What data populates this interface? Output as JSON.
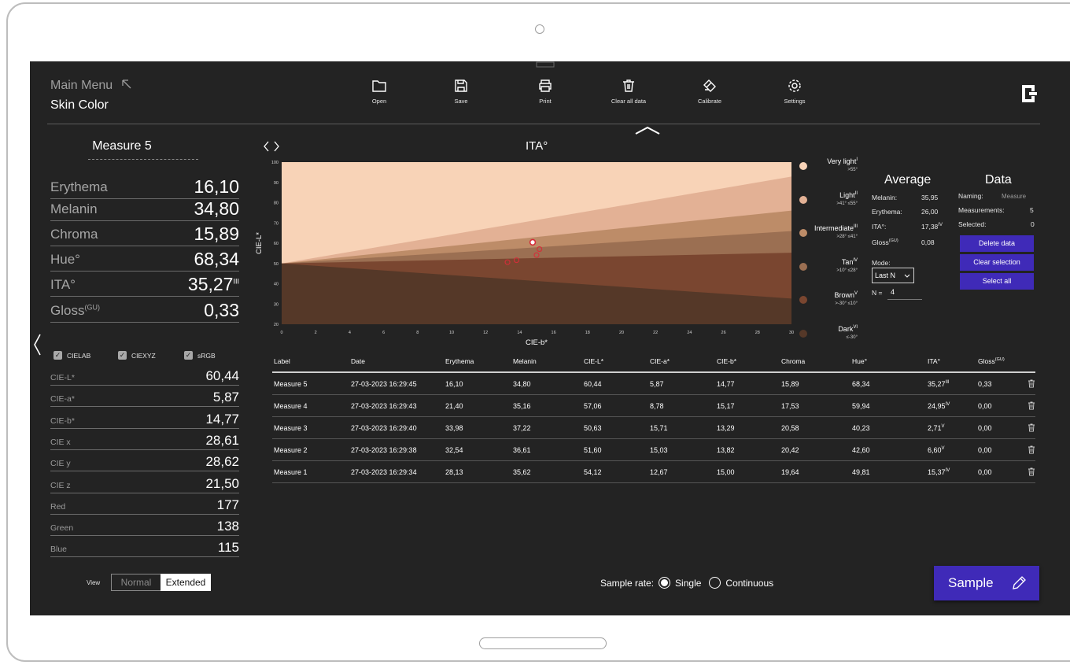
{
  "header": {
    "menu_title": "Main Menu",
    "app_title": "Skin Color",
    "toolbar": [
      {
        "label": "Open",
        "icon": "folder-icon"
      },
      {
        "label": "Save",
        "icon": "save-icon"
      },
      {
        "label": "Print",
        "icon": "print-icon"
      },
      {
        "label": "Clear all data",
        "icon": "trash-icon"
      },
      {
        "label": "Calibrate",
        "icon": "calibrate-icon"
      },
      {
        "label": "Settings",
        "icon": "gear-icon"
      }
    ]
  },
  "measure": {
    "title": "Measure 5",
    "main": [
      {
        "label": "Erythema",
        "value": "16,10"
      },
      {
        "label": "Melanin",
        "value": "34,80"
      },
      {
        "label": "Chroma",
        "value": "15,89"
      },
      {
        "label": "Hue°",
        "value": "68,34"
      },
      {
        "label": "ITA°",
        "value": "35,27",
        "sup": "III"
      },
      {
        "label": "Gloss",
        "label_sup": "(GU)",
        "value": "0,33"
      }
    ],
    "checkboxes": [
      "CIELAB",
      "CIEXYZ",
      "sRGB"
    ],
    "extended": [
      {
        "label": "CIE-L*",
        "value": "60,44"
      },
      {
        "label": "CIE-a*",
        "value": "5,87"
      },
      {
        "label": "CIE-b*",
        "value": "14,77"
      },
      {
        "label": "CIE x",
        "value": "28,61"
      },
      {
        "label": "CIE y",
        "value": "28,62"
      },
      {
        "label": "CIE z",
        "value": "21,50"
      },
      {
        "label": "Red",
        "value": "177"
      },
      {
        "label": "Green",
        "value": "138"
      },
      {
        "label": "Blue",
        "value": "115"
      }
    ],
    "view_label": "View",
    "view_normal": "Normal",
    "view_extended": "Extended"
  },
  "chart_data": {
    "type": "scatter",
    "title": "ITA°",
    "xlabel": "CIE-b*",
    "ylabel": "CIE-L*",
    "xlim": [
      0,
      30
    ],
    "ylim": [
      20,
      100
    ],
    "x_ticks": [
      "0",
      "2",
      "4",
      "6",
      "8",
      "10",
      "12",
      "14",
      "16",
      "18",
      "20",
      "22",
      "24",
      "26",
      "28",
      "30"
    ],
    "y_ticks": [
      "20",
      "30",
      "40",
      "50",
      "60",
      "70",
      "80",
      "90",
      "100"
    ],
    "grid": false,
    "legend_placement": "right",
    "points": [
      {
        "label": "Measure 5",
        "x": 14.77,
        "y": 60.44,
        "selected": true
      },
      {
        "label": "Measure 4",
        "x": 15.17,
        "y": 57.06
      },
      {
        "label": "Measure 3",
        "x": 13.29,
        "y": 50.63
      },
      {
        "label": "Measure 2",
        "x": 13.82,
        "y": 51.6
      },
      {
        "label": "Measure 1",
        "x": 15.0,
        "y": 54.12
      }
    ],
    "categories": [
      {
        "name": "Very light",
        "sup": "I",
        "range": ">55°",
        "color": "#f8d3b7"
      },
      {
        "name": "Light",
        "sup": "II",
        "range": ">41° ≤55°",
        "color": "#e3b195"
      },
      {
        "name": "Intermediate",
        "sup": "III",
        "range": ">28° ≤41°",
        "color": "#bd8c68"
      },
      {
        "name": "Tan",
        "sup": "IV",
        "range": ">10° ≤28°",
        "color": "#9b6f52"
      },
      {
        "name": "Brown",
        "sup": "V",
        "range": ">-30° ≤10°",
        "color": "#7a4630"
      },
      {
        "name": "Dark",
        "sup": "VI",
        "range": "≤-30°",
        "color": "#553828"
      }
    ]
  },
  "average": {
    "title": "Average",
    "rows": [
      {
        "label": "Melanin:",
        "value": "35,95"
      },
      {
        "label": "Erythema:",
        "value": "26,00"
      },
      {
        "label": "ITA°:",
        "value": "17,38",
        "sup": "IV"
      },
      {
        "label": "Gloss",
        "label_sup": "(GU)",
        "value": "0,08"
      }
    ],
    "mode_label": "Mode:",
    "mode_value": "Last N",
    "n_label": "N =",
    "n_value": "4"
  },
  "data_panel": {
    "title": "Data",
    "naming_label": "Naming:",
    "naming_value": "Measure",
    "measurements_label": "Measurements:",
    "measurements_value": "5",
    "selected_label": "Selected:",
    "selected_value": "0",
    "buttons": [
      "Delete data",
      "Clear selection",
      "Select all"
    ]
  },
  "table": {
    "headers": [
      "Label",
      "Date",
      "Erythema",
      "Melanin",
      "CIE-L*",
      "CIE-a*",
      "CIE-b*",
      "Chroma",
      "Hue°",
      "ITA°",
      "Gloss"
    ],
    "gloss_sup": "(GU)",
    "rows": [
      {
        "label": "Measure 5",
        "date": "27-03-2023 16:29:45",
        "erythema": "16,10",
        "melanin": "34,80",
        "l": "60,44",
        "a": "5,87",
        "b": "14,77",
        "chroma": "15,89",
        "hue": "68,34",
        "ita": "35,27",
        "ita_sup": "III",
        "gloss": "0,33"
      },
      {
        "label": "Measure 4",
        "date": "27-03-2023 16:29:43",
        "erythema": "21,40",
        "melanin": "35,16",
        "l": "57,06",
        "a": "8,78",
        "b": "15,17",
        "chroma": "17,53",
        "hue": "59,94",
        "ita": "24,95",
        "ita_sup": "IV",
        "gloss": "0,00"
      },
      {
        "label": "Measure 3",
        "date": "27-03-2023 16:29:40",
        "erythema": "33,98",
        "melanin": "37,22",
        "l": "50,63",
        "a": "15,71",
        "b": "13,29",
        "chroma": "20,58",
        "hue": "40,23",
        "ita": "2,71",
        "ita_sup": "V",
        "gloss": "0,00"
      },
      {
        "label": "Measure 2",
        "date": "27-03-2023 16:29:38",
        "erythema": "32,54",
        "melanin": "36,61",
        "l": "51,60",
        "a": "15,03",
        "b": "13,82",
        "chroma": "20,42",
        "hue": "42,60",
        "ita": "6,60",
        "ita_sup": "V",
        "gloss": "0,00"
      },
      {
        "label": "Measure 1",
        "date": "27-03-2023 16:29:34",
        "erythema": "28,13",
        "melanin": "35,62",
        "l": "54,12",
        "a": "12,67",
        "b": "15,00",
        "chroma": "19,64",
        "hue": "49,81",
        "ita": "15,37",
        "ita_sup": "IV",
        "gloss": "0,00"
      }
    ]
  },
  "footer": {
    "sample_rate_label": "Sample rate:",
    "single": "Single",
    "continuous": "Continuous",
    "sample_button": "Sample"
  },
  "colors": {
    "background": "#232323",
    "accent": "#3f2ab8",
    "point_outline": "#d62d3a"
  }
}
